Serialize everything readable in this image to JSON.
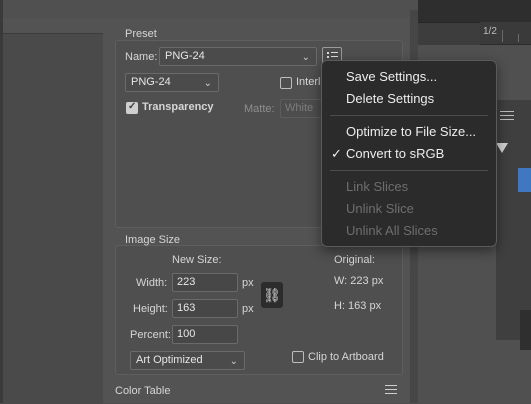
{
  "preset": {
    "section_title": "Preset",
    "name_label": "Name:",
    "name_value": "PNG-24",
    "format_value": "PNG-24",
    "interlaced_label": "Interl",
    "transparency_label": "Transparency",
    "transparency_checked": true,
    "matte_label": "Matte:",
    "matte_value": "White"
  },
  "image_size": {
    "section_title": "Image Size",
    "new_size_label": "New Size:",
    "original_label": "Original:",
    "width_label": "Width:",
    "width_value": "223",
    "height_label": "Height:",
    "height_value": "163",
    "percent_label": "Percent:",
    "percent_value": "100",
    "unit": "px",
    "orig_w": "W:  223 px",
    "orig_h": "H:   163 px",
    "quality_value": "Art Optimized",
    "clip_label": "Clip to Artboard"
  },
  "color_table": {
    "title": "Color Table"
  },
  "app": {
    "ruler_text": "1/2"
  },
  "menu": {
    "items": [
      {
        "label": "Save Settings...",
        "enabled": true
      },
      {
        "label": "Delete Settings",
        "enabled": true
      },
      {
        "label": "Optimize to File Size...",
        "enabled": true
      },
      {
        "label": "Convert to sRGB",
        "enabled": true,
        "checked": true
      },
      {
        "label": "Link Slices",
        "enabled": false
      },
      {
        "label": "Unlink Slice",
        "enabled": false
      },
      {
        "label": "Unlink All Slices",
        "enabled": false
      }
    ]
  }
}
